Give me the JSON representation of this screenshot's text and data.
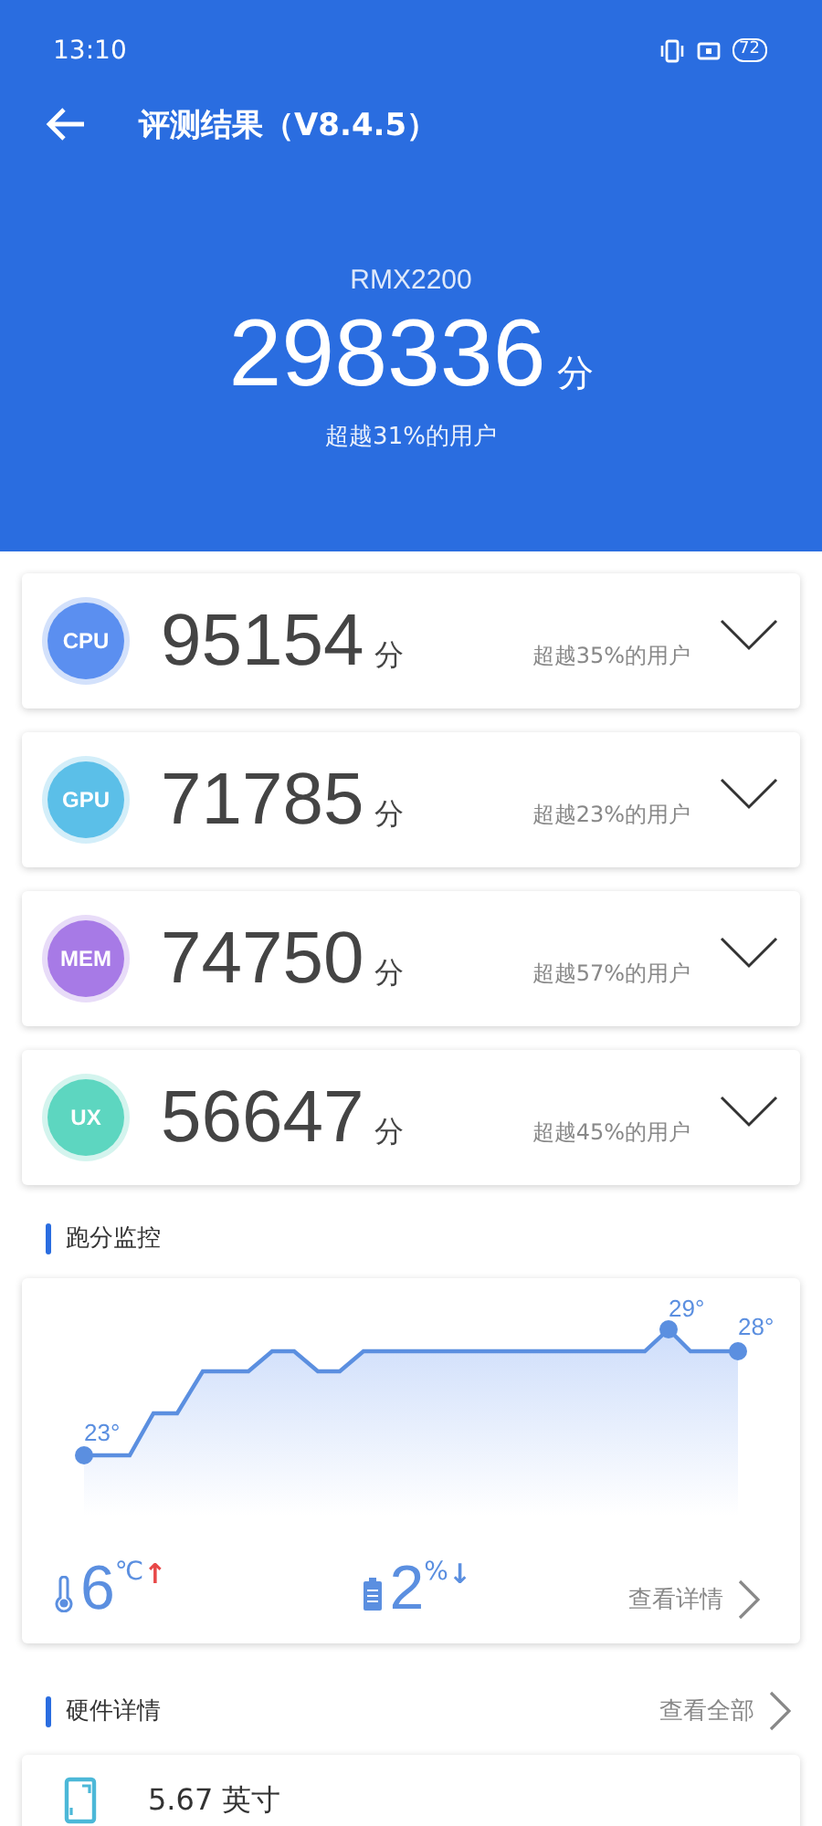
{
  "status_bar": {
    "time": "13:10",
    "battery": "72"
  },
  "header": {
    "title": "评测结果（V8.4.5）",
    "device": "RMX2200",
    "total_score": "298336",
    "unit": "分",
    "rank": "超越31%的用户"
  },
  "scores": [
    {
      "badge": "CPU",
      "color": "#5b8ff0",
      "score": "95154",
      "unit": "分",
      "rank": "超越35%的用户",
      "expanded": false
    },
    {
      "badge": "GPU",
      "color": "#5bbfe8",
      "score": "71785",
      "unit": "分",
      "rank": "超越23%的用户",
      "expanded": false
    },
    {
      "badge": "MEM",
      "color": "#a77ae6",
      "score": "74750",
      "unit": "分",
      "rank": "超越57%的用户",
      "expanded": false
    },
    {
      "badge": "UX",
      "color": "#5dd6c0",
      "score": "56647",
      "unit": "分",
      "rank": "超越45%的用户",
      "expanded": false
    }
  ],
  "monitor": {
    "title": "跑分监控",
    "point_labels": [
      "23°",
      "29°",
      "28°"
    ],
    "temperature": {
      "value": "6",
      "unit": "℃",
      "arrow": "↑"
    },
    "battery": {
      "value": "2",
      "unit": "%",
      "arrow": "↓"
    },
    "link": "查看详情"
  },
  "hardware": {
    "title": "硬件详情",
    "link": "查看全部",
    "items": [
      {
        "text": "5.67 英寸"
      }
    ]
  }
}
